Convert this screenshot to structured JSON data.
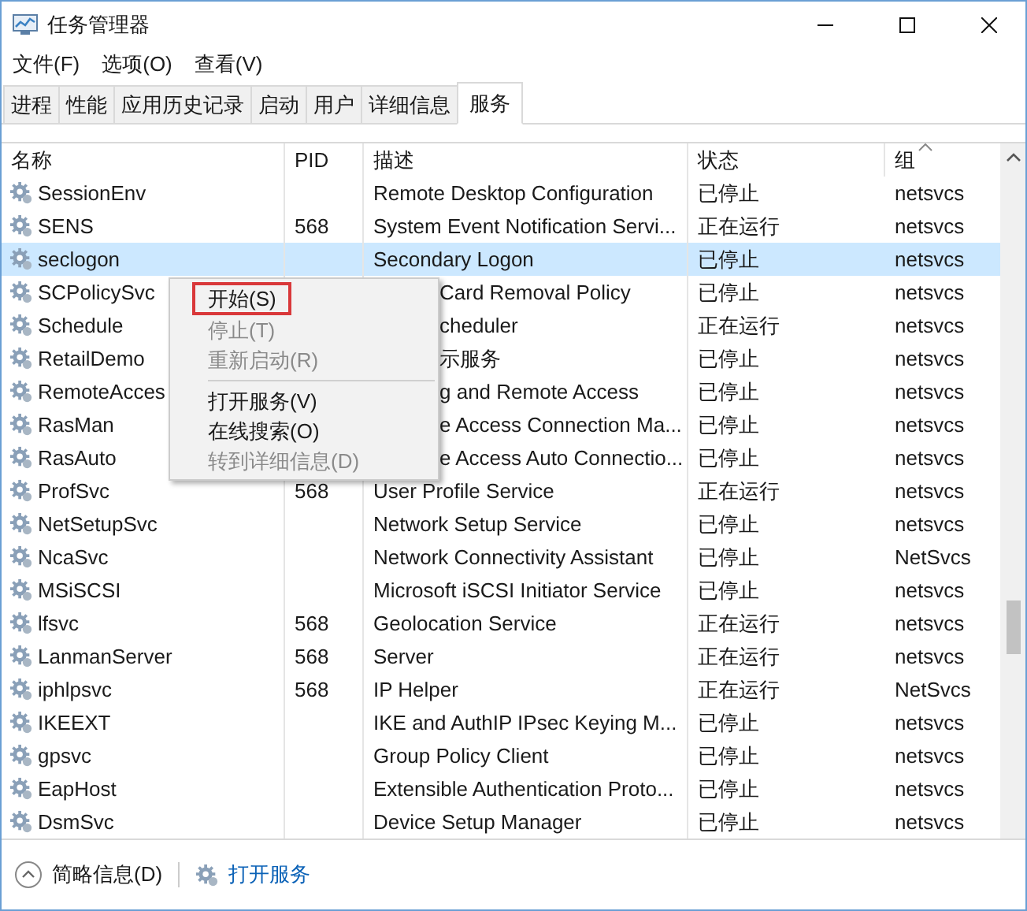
{
  "window": {
    "title": "任务管理器"
  },
  "menu": [
    "文件(F)",
    "选项(O)",
    "查看(V)"
  ],
  "tabs": [
    {
      "label": "进程",
      "selected": false
    },
    {
      "label": "性能",
      "selected": false
    },
    {
      "label": "应用历史记录",
      "selected": false
    },
    {
      "label": "启动",
      "selected": false
    },
    {
      "label": "用户",
      "selected": false
    },
    {
      "label": "详细信息",
      "selected": false
    },
    {
      "label": "服务",
      "selected": true
    }
  ],
  "table": {
    "columns": [
      "名称",
      "PID",
      "描述",
      "状态",
      "组"
    ],
    "rows": [
      {
        "name": "SessionEnv",
        "pid": "",
        "description": "Remote Desktop Configuration",
        "status": "已停止",
        "group": "netsvcs",
        "selected": false
      },
      {
        "name": "SENS",
        "pid": "568",
        "description": "System Event Notification Servi...",
        "status": "正在运行",
        "group": "netsvcs",
        "selected": false
      },
      {
        "name": "seclogon",
        "pid": "",
        "description": "Secondary Logon",
        "status": "已停止",
        "group": "netsvcs",
        "selected": true
      },
      {
        "name": "SCPolicySvc",
        "pid": "",
        "description": "Card Removal Policy",
        "status": "已停止",
        "group": "netsvcs",
        "selected": false
      },
      {
        "name": "Schedule",
        "pid": "",
        "description": "cheduler",
        "status": "正在运行",
        "group": "netsvcs",
        "selected": false
      },
      {
        "name": "RetailDemo",
        "pid": "",
        "description": "示服务",
        "status": "已停止",
        "group": "netsvcs",
        "selected": false
      },
      {
        "name": "RemoteAcces",
        "pid": "",
        "description": "g and Remote Access",
        "status": "已停止",
        "group": "netsvcs",
        "selected": false
      },
      {
        "name": "RasMan",
        "pid": "",
        "description": "e Access Connection Ma...",
        "status": "已停止",
        "group": "netsvcs",
        "selected": false
      },
      {
        "name": "RasAuto",
        "pid": "",
        "description": "e Access Auto Connectio...",
        "status": "已停止",
        "group": "netsvcs",
        "selected": false
      },
      {
        "name": "ProfSvc",
        "pid": "568",
        "description": "User Profile Service",
        "status": "正在运行",
        "group": "netsvcs",
        "selected": false
      },
      {
        "name": "NetSetupSvc",
        "pid": "",
        "description": "Network Setup Service",
        "status": "已停止",
        "group": "netsvcs",
        "selected": false
      },
      {
        "name": "NcaSvc",
        "pid": "",
        "description": "Network Connectivity Assistant",
        "status": "已停止",
        "group": "NetSvcs",
        "selected": false
      },
      {
        "name": "MSiSCSI",
        "pid": "",
        "description": "Microsoft iSCSI Initiator Service",
        "status": "已停止",
        "group": "netsvcs",
        "selected": false
      },
      {
        "name": "lfsvc",
        "pid": "568",
        "description": "Geolocation Service",
        "status": "正在运行",
        "group": "netsvcs",
        "selected": false
      },
      {
        "name": "LanmanServer",
        "pid": "568",
        "description": "Server",
        "status": "正在运行",
        "group": "netsvcs",
        "selected": false
      },
      {
        "name": "iphlpsvc",
        "pid": "568",
        "description": "IP Helper",
        "status": "正在运行",
        "group": "NetSvcs",
        "selected": false
      },
      {
        "name": "IKEEXT",
        "pid": "",
        "description": "IKE and AuthIP IPsec Keying M...",
        "status": "已停止",
        "group": "netsvcs",
        "selected": false
      },
      {
        "name": "gpsvc",
        "pid": "",
        "description": "Group Policy Client",
        "status": "已停止",
        "group": "netsvcs",
        "selected": false
      },
      {
        "name": "EapHost",
        "pid": "",
        "description": "Extensible Authentication Proto...",
        "status": "已停止",
        "group": "netsvcs",
        "selected": false
      },
      {
        "name": "DsmSvc",
        "pid": "",
        "description": "Device Setup Manager",
        "status": "已停止",
        "group": "netsvcs",
        "selected": false
      }
    ]
  },
  "context_menu": [
    {
      "kind": "item",
      "label": "开始(S)",
      "disabled": false,
      "selected": true
    },
    {
      "kind": "item",
      "label": "停止(T)",
      "disabled": true,
      "selected": false
    },
    {
      "kind": "item",
      "label": "重新启动(R)",
      "disabled": true,
      "selected": false
    },
    {
      "kind": "separator"
    },
    {
      "kind": "item",
      "label": "打开服务(V)",
      "disabled": false,
      "selected": false
    },
    {
      "kind": "item",
      "label": "在线搜索(O)",
      "disabled": false,
      "selected": false
    },
    {
      "kind": "item",
      "label": "转到详细信息(D)",
      "disabled": true,
      "selected": false
    }
  ],
  "footer": {
    "collapse": "简略信息(D)",
    "link": "打开服务"
  }
}
